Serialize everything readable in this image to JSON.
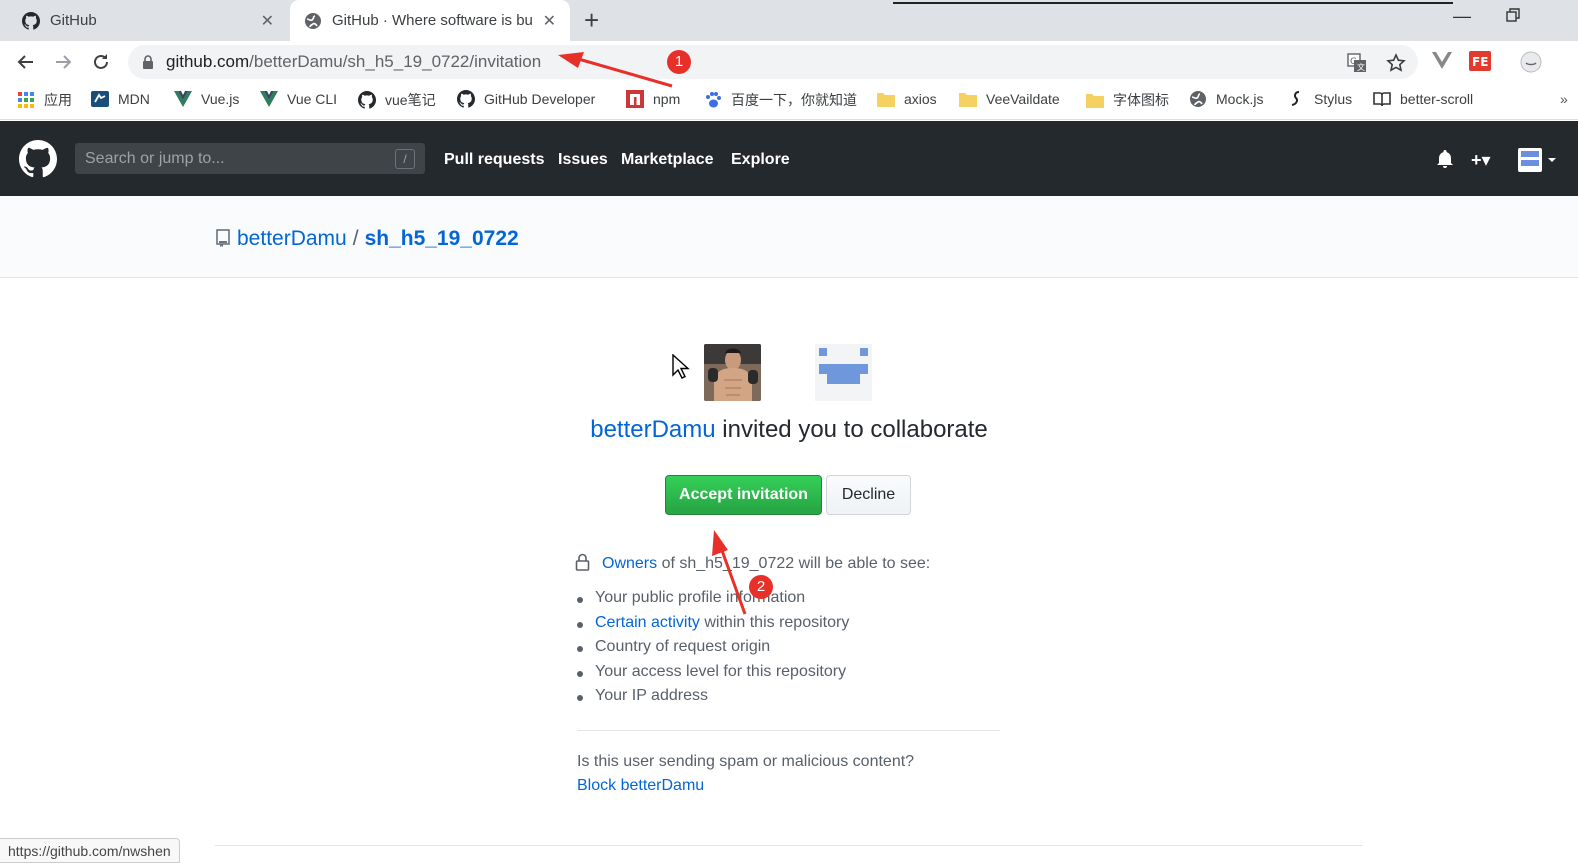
{
  "browser": {
    "tabs": [
      {
        "title": "GitHub",
        "close": "✕"
      },
      {
        "title": "GitHub · Where software is bu",
        "close": "✕"
      }
    ],
    "new_tab": "+",
    "url_host": "github.com",
    "url_path": "/betterDamu/sh_h5_19_0722/invitation",
    "bookmarks": [
      "应用",
      "MDN",
      "Vue.js",
      "Vue CLI",
      "vue笔记",
      "GitHub Developer",
      "npm",
      "百度一下，你就知道",
      "axios",
      "VeeVaildate",
      "字体图标",
      "Mock.js",
      "Stylus",
      "better-scroll"
    ],
    "bookmarks_more": "»"
  },
  "github_header": {
    "search_placeholder": "Search or jump to...",
    "search_shortcut": "/",
    "nav": [
      "Pull requests",
      "Issues",
      "Marketplace",
      "Explore"
    ],
    "plus": "+▾"
  },
  "repo": {
    "owner": "betterDamu",
    "separator": "/",
    "name": "sh_h5_19_0722"
  },
  "invitation": {
    "inviter": "betterDamu",
    "message": " invited you to collaborate",
    "accept_label": "Accept invitation",
    "decline_label": "Decline",
    "owners_link": "Owners",
    "owners_text": " of sh_h5_19_0722 will be able to see:",
    "permissions": [
      {
        "link": "",
        "text": "Your public profile information"
      },
      {
        "link": "Certain activity",
        "text": " within this repository"
      },
      {
        "link": "",
        "text": "Country of request origin"
      },
      {
        "link": "",
        "text": "Your access level for this repository"
      },
      {
        "link": "",
        "text": "Your IP address"
      }
    ],
    "spam_question": "Is this user sending spam or malicious content?",
    "block_link": "Block betterDamu"
  },
  "status_bar": "https://github.com/nwshen",
  "annotations": [
    "1",
    "2"
  ],
  "colors": {
    "github_header": "#24292e",
    "link": "#0366d6",
    "accept_green": "#28a745",
    "annotation_red": "#e8302a"
  }
}
